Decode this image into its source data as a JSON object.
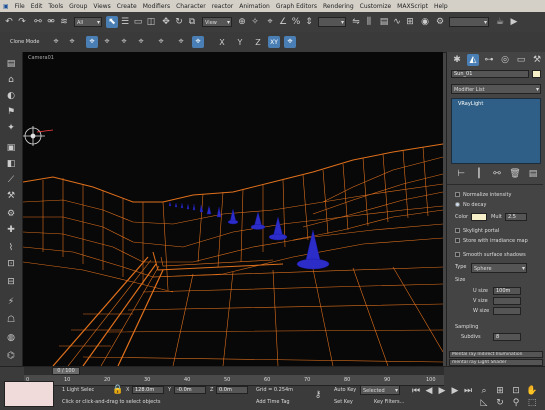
{
  "menu": [
    "File",
    "Edit",
    "Tools",
    "Group",
    "Views",
    "Create",
    "Modifiers",
    "Character",
    "reactor",
    "Animation",
    "Graph Editors",
    "Rendering",
    "Customize",
    "MAXScript",
    "Help"
  ],
  "main_toolbar": {
    "selection_filter": "All",
    "ref_coord": "View"
  },
  "sub_toolbar": {
    "label": "Clone Mode",
    "axis_x": "X",
    "axis_y": "Y",
    "axis_z": "Z",
    "axis_xy": "XY"
  },
  "viewport": {
    "label": "Camera01"
  },
  "command_panel": {
    "object_name": "Sun_01",
    "modifier_list": "Modifier List",
    "stack_item": "VRayLight",
    "options": {
      "normalize_intensity": "Normalize intensity",
      "no_decay": "No decay",
      "color_label": "Color",
      "color_swatch": "#f6efc8",
      "mult_label": "Mult",
      "mult_value": "2.5",
      "skylight_portal": "Skylight portal",
      "store_irradiance": "Store with irradiance map",
      "smooth_surface": "Smooth surface shadows",
      "type_label": "Type",
      "type_value": "Sphere",
      "size_label": "Size",
      "u_size_label": "U size",
      "u_size_value": "100m",
      "v_size_label": "V size",
      "w_size_label": "W size",
      "sampling_label": "Sampling",
      "subdivs_label": "Subdivs",
      "subdivs_value": "8"
    },
    "rollout_1": "Mental ray Indirect Illumination",
    "rollout_2": "mental ray Light Shader"
  },
  "timeline": {
    "slider_label": "0 / 100",
    "ticks": [
      "0",
      "10",
      "20",
      "30",
      "40",
      "50",
      "60",
      "70",
      "80",
      "90",
      "100"
    ]
  },
  "status": {
    "selection": "1 Light Selec",
    "hint": "Click or click-and-drag to select objects",
    "x_label": "X",
    "x_value": "128.0m",
    "y_label": "Y",
    "y_value": "-0.0m",
    "z_label": "Z",
    "z_value": "0.0m",
    "grid": "Grid = 0.254m",
    "add_time_tag": "Add Time Tag",
    "auto_key": "Auto Key",
    "set_key": "Set Key",
    "key_mode": "Selected",
    "key_filters": "Key Filters..."
  },
  "colors": {
    "wire": "#e0701c",
    "cone": "#2c2cc8",
    "accent": "#4a7fb5"
  }
}
